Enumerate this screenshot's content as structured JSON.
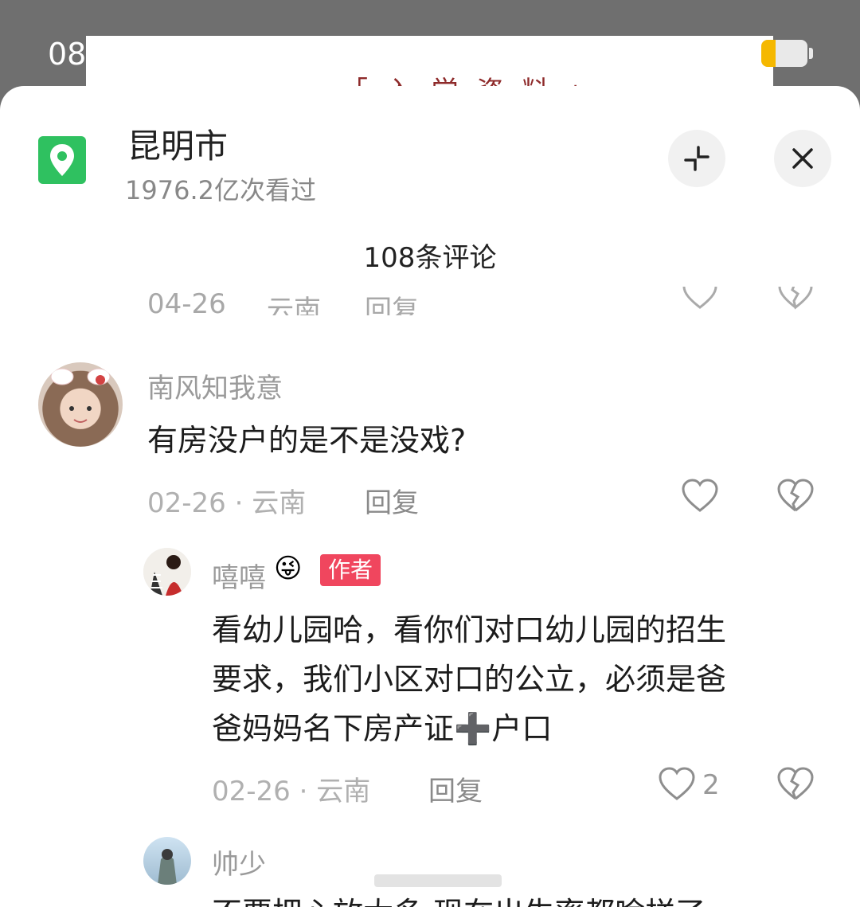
{
  "status": {
    "time": "08"
  },
  "background_doc": {
    "text": "「 入 学 资 料 」"
  },
  "header": {
    "location_title": "昆明市",
    "views": "1976.2亿次看过",
    "collapse_icon": "collapse-icon",
    "close_icon": "close-icon",
    "comment_count": "108条评论"
  },
  "cut_row": {
    "date": "04-26",
    "region": "云南",
    "reply": "回复"
  },
  "comments": [
    {
      "name": "南风知我意",
      "text": "有房没户的是不是没戏?",
      "date_region": "02-26 · 云南",
      "reply": "回复",
      "likes": ""
    },
    {
      "name": "嘻嘻",
      "emoji": "😜",
      "tag": "作者",
      "lines": [
        "看幼儿园哈，看你们对口幼儿园的招生",
        "要求，我们小区对口的公立，必须是爸",
        "爸妈妈名下房产证➕户口"
      ],
      "date_region": "02-26 · 云南",
      "reply": "回复",
      "likes": "2"
    },
    {
      "name": "帅少",
      "partial_text": "不要把心放太多 现在出生率都啥样了"
    }
  ],
  "colors": {
    "accent_green": "#2fc160",
    "author_tag": "#f0465e",
    "battery": "#f5b800"
  }
}
